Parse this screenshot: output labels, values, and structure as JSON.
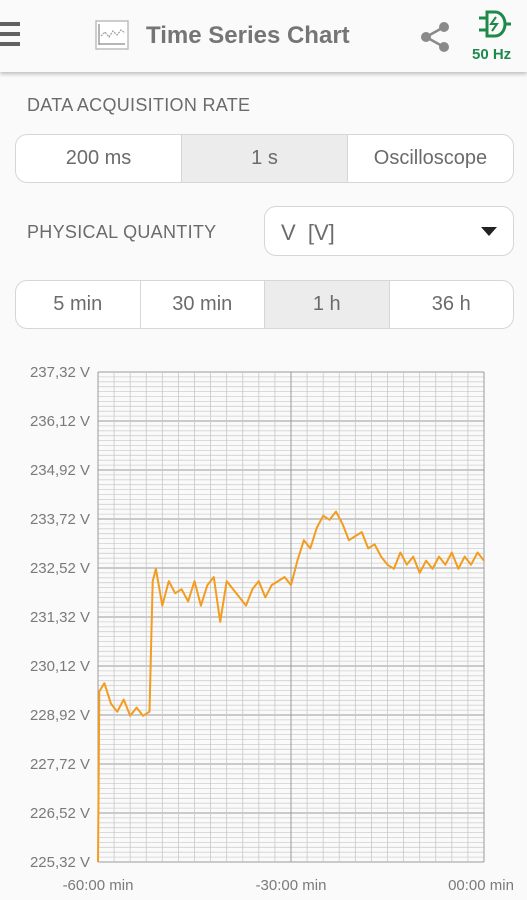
{
  "app": {
    "title": "Time Series Chart",
    "frequency": "50 Hz",
    "icons": [
      "menu-icon",
      "chart-app-icon",
      "share-icon",
      "plug-icon"
    ],
    "accent_color": "#1e8a4a"
  },
  "acquisition": {
    "label": "DATA ACQUISITION RATE",
    "options": [
      "200 ms",
      "1 s",
      "Oscilloscope"
    ],
    "selected": "1 s"
  },
  "quantity": {
    "label": "PHYSICAL QUANTITY",
    "value": "V  [V]"
  },
  "range": {
    "options": [
      "5 min",
      "30 min",
      "1 h",
      "36 h"
    ],
    "selected": "1 h"
  },
  "chart_data": {
    "type": "line",
    "color": "#f39c1f",
    "y_ticks": [
      "237,32 V",
      "236,12 V",
      "234,92 V",
      "233,72 V",
      "232,52 V",
      "231,32 V",
      "230,12 V",
      "228,92 V",
      "227,72 V",
      "226,52 V",
      "225,32 V"
    ],
    "x_ticks": [
      "-60:00 min",
      "-30:00 min",
      "00:00 min"
    ],
    "xlim": [
      -60,
      0
    ],
    "ylim": [
      225.32,
      237.32
    ],
    "grid": true,
    "series": [
      {
        "x": [
          -60,
          -59.8,
          -59,
          -58,
          -57,
          -56,
          -55,
          -54,
          -53,
          -52,
          -51.5,
          -51,
          -50,
          -49,
          -48,
          -47,
          -46,
          -45,
          -44,
          -43,
          -42,
          -41,
          -40,
          -39,
          -38,
          -37,
          -36,
          -35,
          -34,
          -33,
          -32,
          -31,
          -30,
          -29,
          -28,
          -27,
          -26,
          -25,
          -24,
          -23,
          -22,
          -21,
          -20,
          -19,
          -18,
          -17,
          -16,
          -15,
          -14,
          -13,
          -12,
          -11,
          -10,
          -9,
          -8,
          -7,
          -6,
          -5,
          -4,
          -3,
          -2,
          -1,
          0
        ],
        "y": [
          225.32,
          229.5,
          229.7,
          229.2,
          229.0,
          229.3,
          228.9,
          229.1,
          228.9,
          229.0,
          232.2,
          232.5,
          231.6,
          232.2,
          231.9,
          232.0,
          231.7,
          232.2,
          231.6,
          232.1,
          232.3,
          231.2,
          232.2,
          232.0,
          231.8,
          231.6,
          232.0,
          232.2,
          231.8,
          232.1,
          232.2,
          232.3,
          232.1,
          232.7,
          233.2,
          233.0,
          233.5,
          233.8,
          233.7,
          233.9,
          233.6,
          233.2,
          233.3,
          233.4,
          233.0,
          233.1,
          232.8,
          232.6,
          232.5,
          232.9,
          232.6,
          232.8,
          232.4,
          232.7,
          232.5,
          232.8,
          232.6,
          232.9,
          232.5,
          232.8,
          232.6,
          232.9,
          232.7
        ]
      }
    ]
  }
}
